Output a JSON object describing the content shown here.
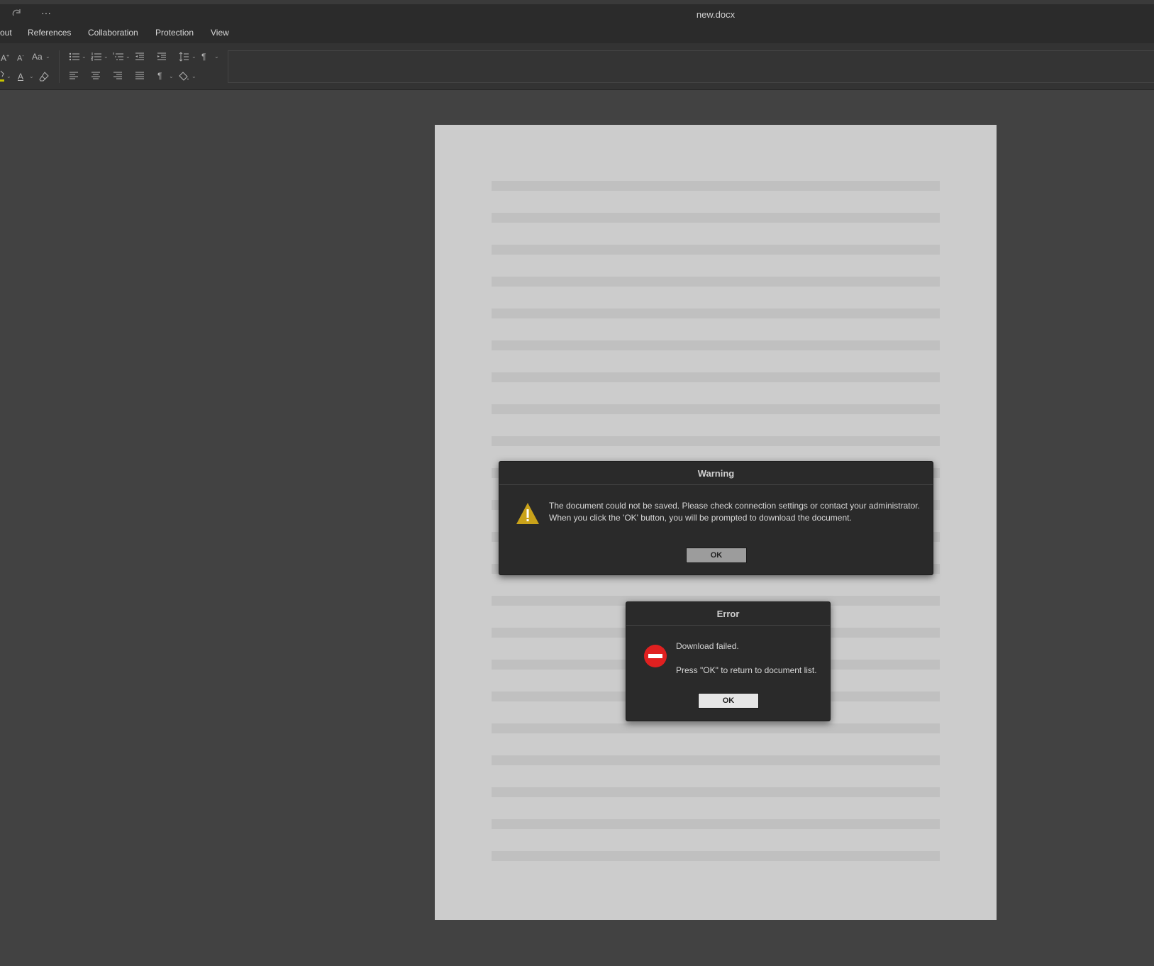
{
  "titlebar": {
    "title": "new.docx",
    "redo_icon": "redo-icon",
    "more_label": "···"
  },
  "tabs": [
    {
      "label": "out"
    },
    {
      "label": "References"
    },
    {
      "label": "Collaboration"
    },
    {
      "label": "Protection"
    },
    {
      "label": "View"
    }
  ],
  "toolbar": {
    "font_size_up": "A",
    "font_size_down": "A",
    "change_case": "Aa",
    "font_color": "A",
    "pilcrow": "¶",
    "pilcrow2": "¶",
    "highlight_color": "#c8c400",
    "dropdown_glyph": "⌄"
  },
  "warning_dialog": {
    "title": "Warning",
    "message_line1": "The document could not be saved. Please check connection settings or contact your administrator.",
    "message_line2": "When you click the 'OK' button, you will be prompted to download the document.",
    "ok_label": "OK",
    "icon": "warning-triangle-icon",
    "icon_color": "#c9a21a"
  },
  "error_dialog": {
    "title": "Error",
    "message_line1": "Download failed.",
    "message_line2": "Press \"OK\" to return to document list.",
    "ok_label": "OK",
    "icon": "error-no-entry-icon",
    "icon_color": "#e02020"
  }
}
